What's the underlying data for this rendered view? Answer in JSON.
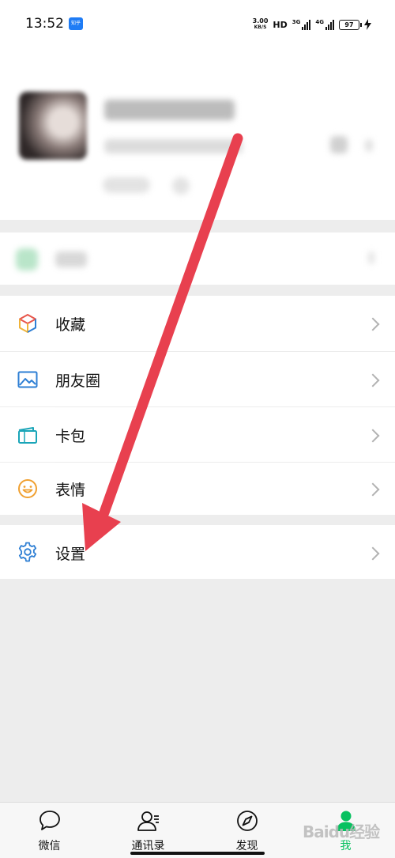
{
  "status": {
    "time": "13:52",
    "app_badge": "知乎",
    "netspeed_value": "3.00",
    "netspeed_unit": "KB/S",
    "hd": "HD",
    "net1": "3G",
    "net2": "4G",
    "battery": "97"
  },
  "menu": {
    "favorites": "收藏",
    "moments": "朋友圈",
    "cards": "卡包",
    "stickers": "表情",
    "settings": "设置"
  },
  "tabs": {
    "chats": "微信",
    "contacts": "通讯录",
    "discover": "发现",
    "me": "我"
  },
  "watermark": "Baidu经验",
  "colors": {
    "accent": "#07c160",
    "arrow": "#e8404f",
    "icon_blue": "#2e7fd4"
  }
}
